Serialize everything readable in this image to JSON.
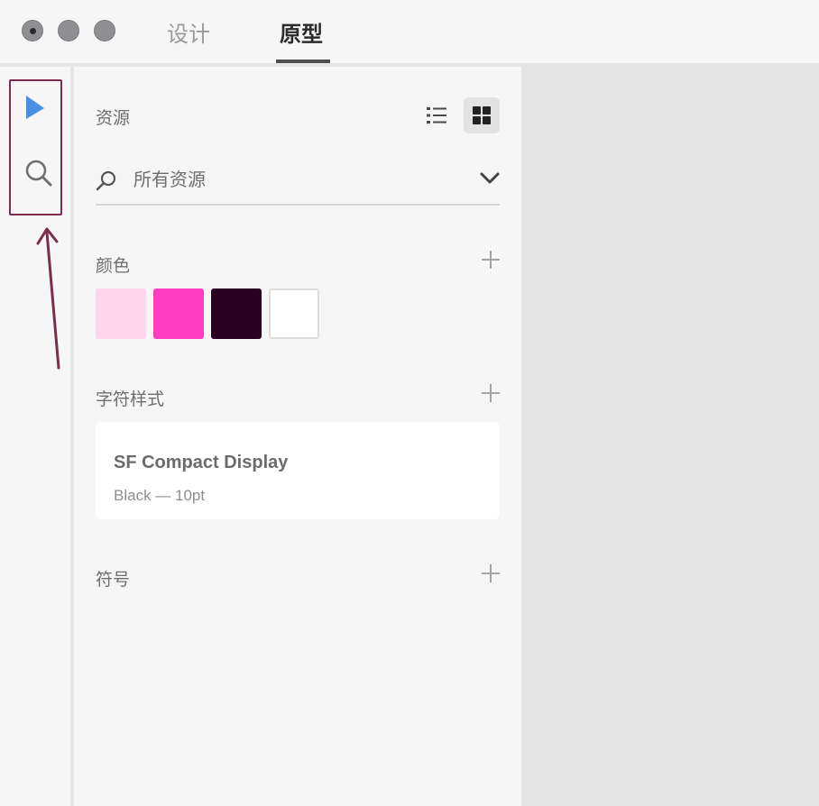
{
  "window": {
    "controls": [
      "close",
      "minimize",
      "zoom"
    ]
  },
  "tabs": [
    {
      "label": "设计",
      "active": false
    },
    {
      "label": "原型",
      "active": true
    }
  ],
  "toolbar": {
    "tools": [
      {
        "name": "select-tool",
        "icon": "pointer-arrow-icon",
        "color": "#4a90e2"
      },
      {
        "name": "search-tool",
        "icon": "search-icon",
        "color": "#6e6e6e"
      }
    ]
  },
  "assets": {
    "title": "资源",
    "view_modes": [
      {
        "icon": "list-view-icon",
        "selected": false
      },
      {
        "icon": "grid-view-icon",
        "selected": true
      }
    ],
    "search": {
      "icon": "search-icon",
      "placeholder": "所有资源",
      "value": "",
      "dropdown_icon": "chevron-down-icon"
    },
    "colors_section": {
      "title": "颜色",
      "swatches": [
        "#ffd6ec",
        "#ff3dbf",
        "#2a0020",
        "#ffffff"
      ]
    },
    "char_styles_section": {
      "title": "字符样式",
      "items": [
        {
          "font": "SF Compact Display",
          "meta": "Black — 10pt"
        }
      ]
    },
    "symbols_section": {
      "title": "符号"
    }
  },
  "annotation": {
    "color": "#7b2d4d"
  }
}
